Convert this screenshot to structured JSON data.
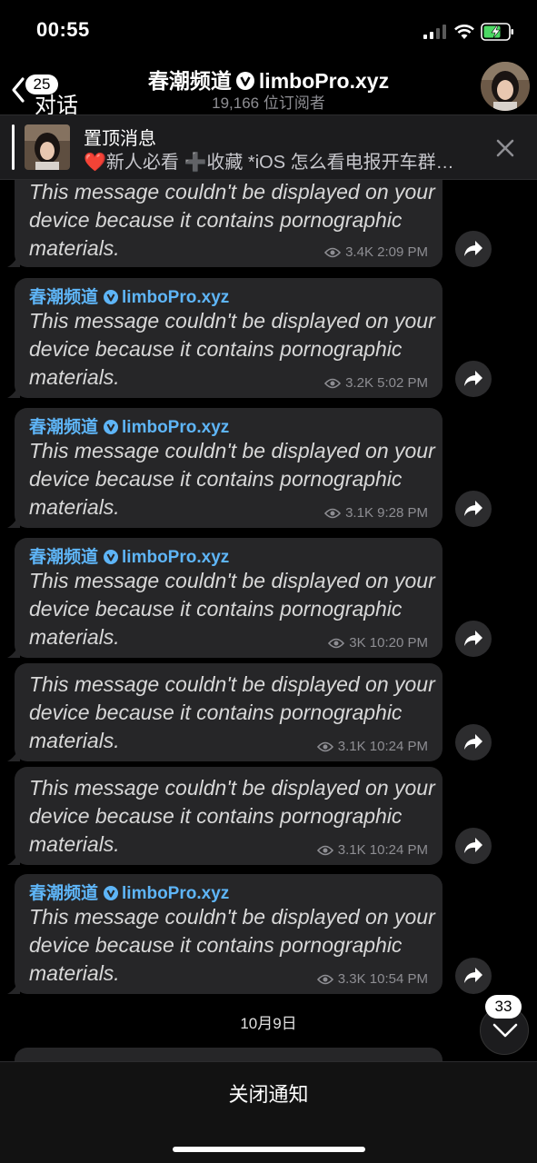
{
  "status_bar": {
    "time": "00:55",
    "signal_icon": "signal-icon",
    "wifi_icon": "wifi-icon",
    "battery_icon": "battery-charging-icon"
  },
  "header": {
    "back_badge": "25",
    "back_label": "对话",
    "channel_name": "春潮频道",
    "channel_handle": "limboPro.xyz",
    "subscribers": "19,166 位订阅者"
  },
  "pinned": {
    "title": "置顶消息",
    "text": "❤️新人必看 ➕收藏 *iOS 怎么看电报开车群…"
  },
  "messages": [
    {
      "author": "",
      "handle": "",
      "text": "This message couldn't be displayed on your device because it contains pornographic materials.",
      "views": "3.4K",
      "time": "2:09 PM"
    },
    {
      "author": "春潮频道",
      "handle": "limboPro.xyz",
      "text": "This message couldn't be displayed on your device because it contains pornographic materials.",
      "views": "3.2K",
      "time": "5:02 PM"
    },
    {
      "author": "春潮频道",
      "handle": "limboPro.xyz",
      "text": "This message couldn't be displayed on your device because it contains pornographic materials.",
      "views": "3.1K",
      "time": "9:28 PM"
    },
    {
      "author": "春潮频道",
      "handle": "limboPro.xyz",
      "text": "This message couldn't be displayed on your device because it contains pornographic materials.",
      "views": "3K",
      "time": "10:20 PM"
    },
    {
      "author": "",
      "handle": "",
      "text": "This message couldn't be displayed on your device because it contains pornographic materials.",
      "views": "3.1K",
      "time": "10:24 PM"
    },
    {
      "author": "",
      "handle": "",
      "text": "This message couldn't be displayed on your device because it contains pornographic materials.",
      "views": "3.1K",
      "time": "10:24 PM"
    },
    {
      "author": "春潮频道",
      "handle": "limboPro.xyz",
      "text": "This message couldn't be displayed on your device because it contains pornographic materials.",
      "views": "3.3K",
      "time": "10:54 PM"
    }
  ],
  "date_separator": "10月9日",
  "scroll_badge": "33",
  "bottom_button": "关闭通知",
  "colors": {
    "accent": "#5eb5f7",
    "bubble": "#262628",
    "background": "#000000"
  }
}
